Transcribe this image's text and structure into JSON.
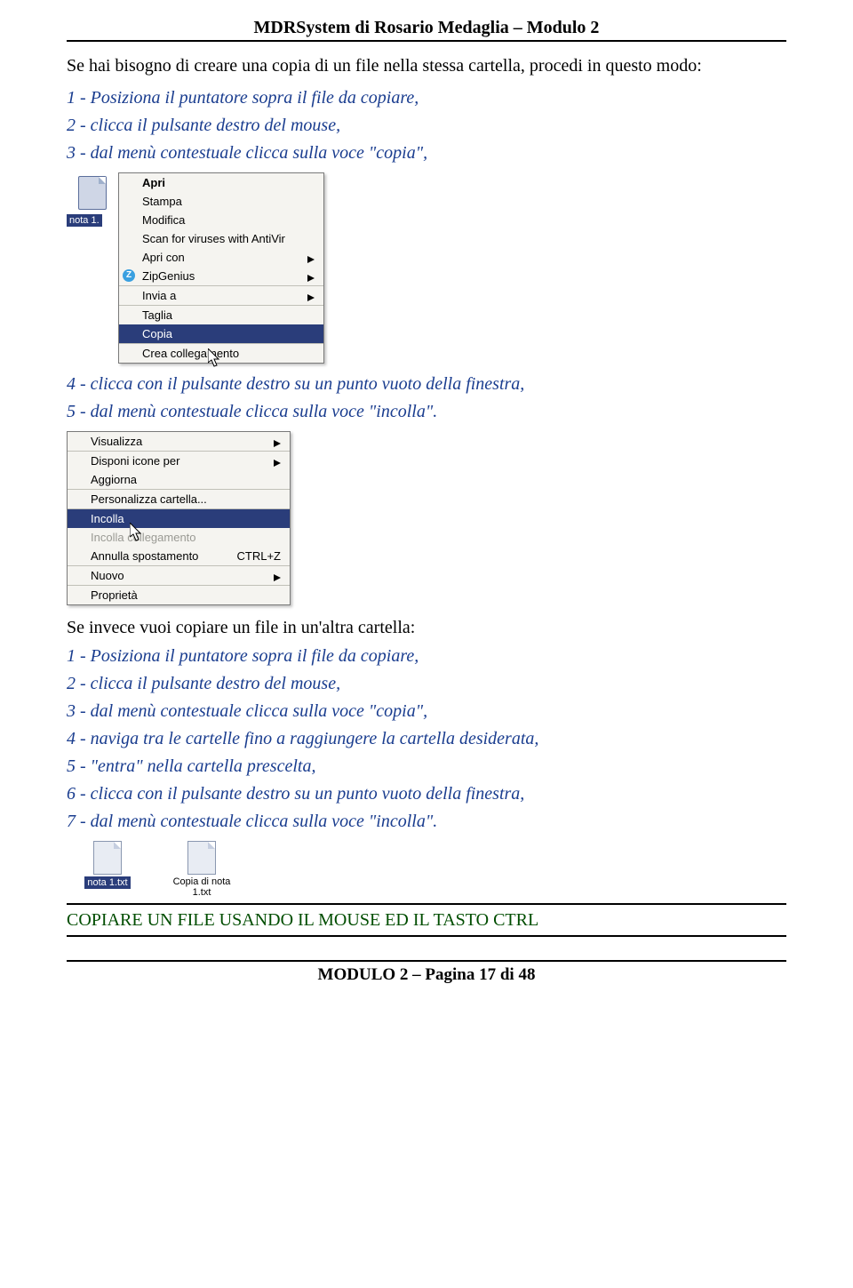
{
  "header": "MDRSystem di Rosario Medaglia – Modulo 2",
  "intro": "Se hai bisogno di creare una copia di un file nella stessa cartella, procedi in questo modo:",
  "stepsA": {
    "s1": "1 - Posiziona il puntatore sopra il file da copiare,",
    "s2": "2 - clicca il pulsante destro del mouse,",
    "s3": "3 - dal menù contestuale clicca sulla voce \"copia\","
  },
  "file1_label": "nota 1.",
  "menu1": {
    "apri": "Apri",
    "stampa": "Stampa",
    "modifica": "Modifica",
    "scan": "Scan for viruses with AntiVir",
    "apricon": "Apri con",
    "zipgenius": "ZipGenius",
    "inviaa": "Invia a",
    "taglia": "Taglia",
    "copia": "Copia",
    "crea": "Crea collegamento"
  },
  "stepsA2": {
    "s4": "4 - clicca con il pulsante destro su un punto vuoto della finestra,",
    "s5": "5 - dal menù contestuale clicca sulla voce \"incolla\"."
  },
  "menu2": {
    "visualizza": "Visualizza",
    "disponi": "Disponi icone per",
    "aggiorna": "Aggiorna",
    "personalizza": "Personalizza cartella...",
    "incolla": "Incolla",
    "incollacoll": "Incolla collegamento",
    "annulla": "Annulla spostamento",
    "annulla_sc": "CTRL+Z",
    "nuovo": "Nuovo",
    "proprieta": "Proprietà"
  },
  "intro2": "Se invece vuoi copiare un file in un'altra cartella:",
  "stepsB": {
    "s1": "1 - Posiziona il puntatore sopra il file da copiare,",
    "s2": "2 - clicca il pulsante destro del mouse,",
    "s3": "3 - dal menù contestuale clicca sulla voce \"copia\",",
    "s4": "4 - naviga tra le cartelle fino a raggiungere la cartella desiderata,",
    "s5": "5 - \"entra\" nella cartella prescelta,",
    "s6": "6 - clicca con il pulsante destro su un punto vuoto della finestra,",
    "s7": "7 - dal menù contestuale clicca sulla voce \"incolla\"."
  },
  "files": {
    "f1": "nota 1.txt",
    "f2a": "Copia di nota",
    "f2b": "1.txt"
  },
  "section_title": "COPIARE UN FILE USANDO IL MOUSE ED IL TASTO CTRL",
  "footer": "MODULO 2 – Pagina 17 di 48"
}
